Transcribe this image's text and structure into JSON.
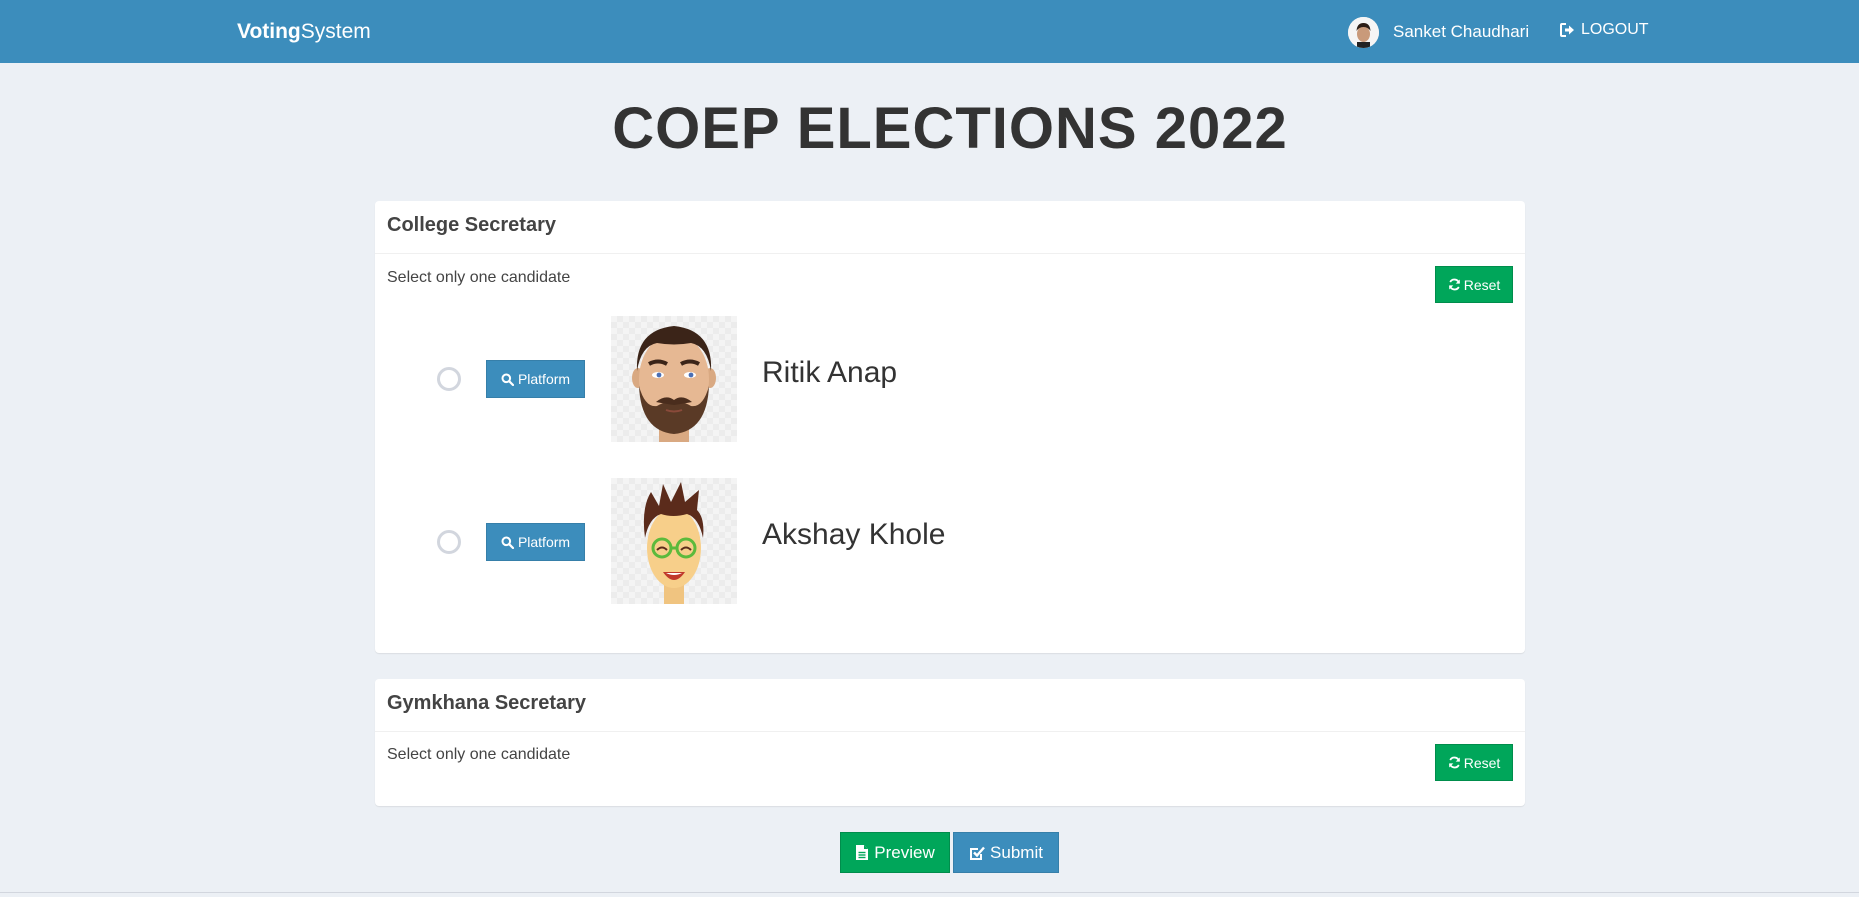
{
  "header": {
    "brand_bold": "Voting",
    "brand_rest": "System",
    "user_name": "Sanket Chaudhari",
    "logout_label": "LOGOUT"
  },
  "page": {
    "title": "COEP ELECTIONS 2022"
  },
  "positions": [
    {
      "title": "College Secretary",
      "instruction": "Select only one candidate",
      "reset_label": "Reset",
      "candidates": [
        {
          "name": "Ritik Anap",
          "platform_label": "Platform",
          "selected": false
        },
        {
          "name": "Akshay Khole",
          "platform_label": "Platform",
          "selected": false
        }
      ]
    },
    {
      "title": "Gymkhana Secretary",
      "instruction": "Select only one candidate",
      "reset_label": "Reset",
      "candidates": []
    }
  ],
  "footer": {
    "preview_label": "Preview",
    "submit_label": "Submit"
  },
  "colors": {
    "header_bg": "#3c8dbc",
    "page_bg": "#ecf0f5",
    "success": "#00a65a",
    "primary": "#3c8dbc"
  },
  "icons": {
    "logout": "sign-out-icon",
    "reset": "refresh-icon",
    "platform": "search-icon",
    "preview": "file-text-icon",
    "submit": "check-square-icon"
  }
}
